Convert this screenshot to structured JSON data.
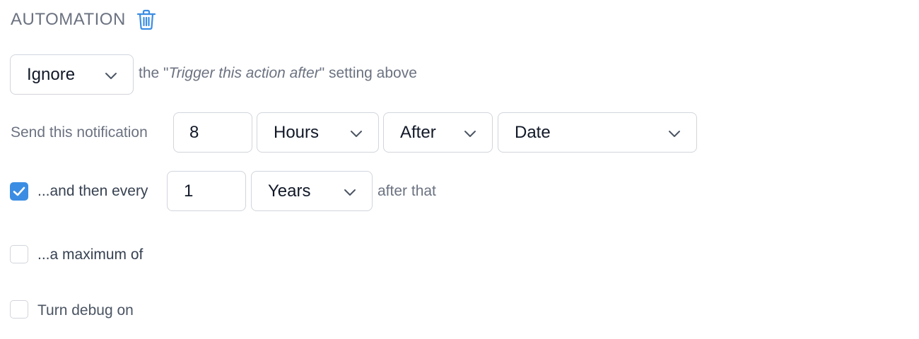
{
  "automation": {
    "title": "AUTOMATION",
    "trash_icon": "trash-icon",
    "accent_color": "#3b8de3"
  },
  "ignore_row": {
    "select_value": "Ignore",
    "text_prefix": "the \"",
    "text_italic": "Trigger this action after",
    "text_suffix": "\" setting above"
  },
  "send_row": {
    "label": "Send this notification",
    "amount_value": "8",
    "unit_value": "Hours",
    "direction_value": "After",
    "reference_value": "Date"
  },
  "repeat_row": {
    "checked": true,
    "label": "...and then every",
    "amount_value": "1",
    "unit_value": "Years",
    "suffix": "after that"
  },
  "maximum_row": {
    "checked": false,
    "label": "...a maximum of"
  },
  "debug_row": {
    "checked": false,
    "label": "Turn debug on"
  }
}
